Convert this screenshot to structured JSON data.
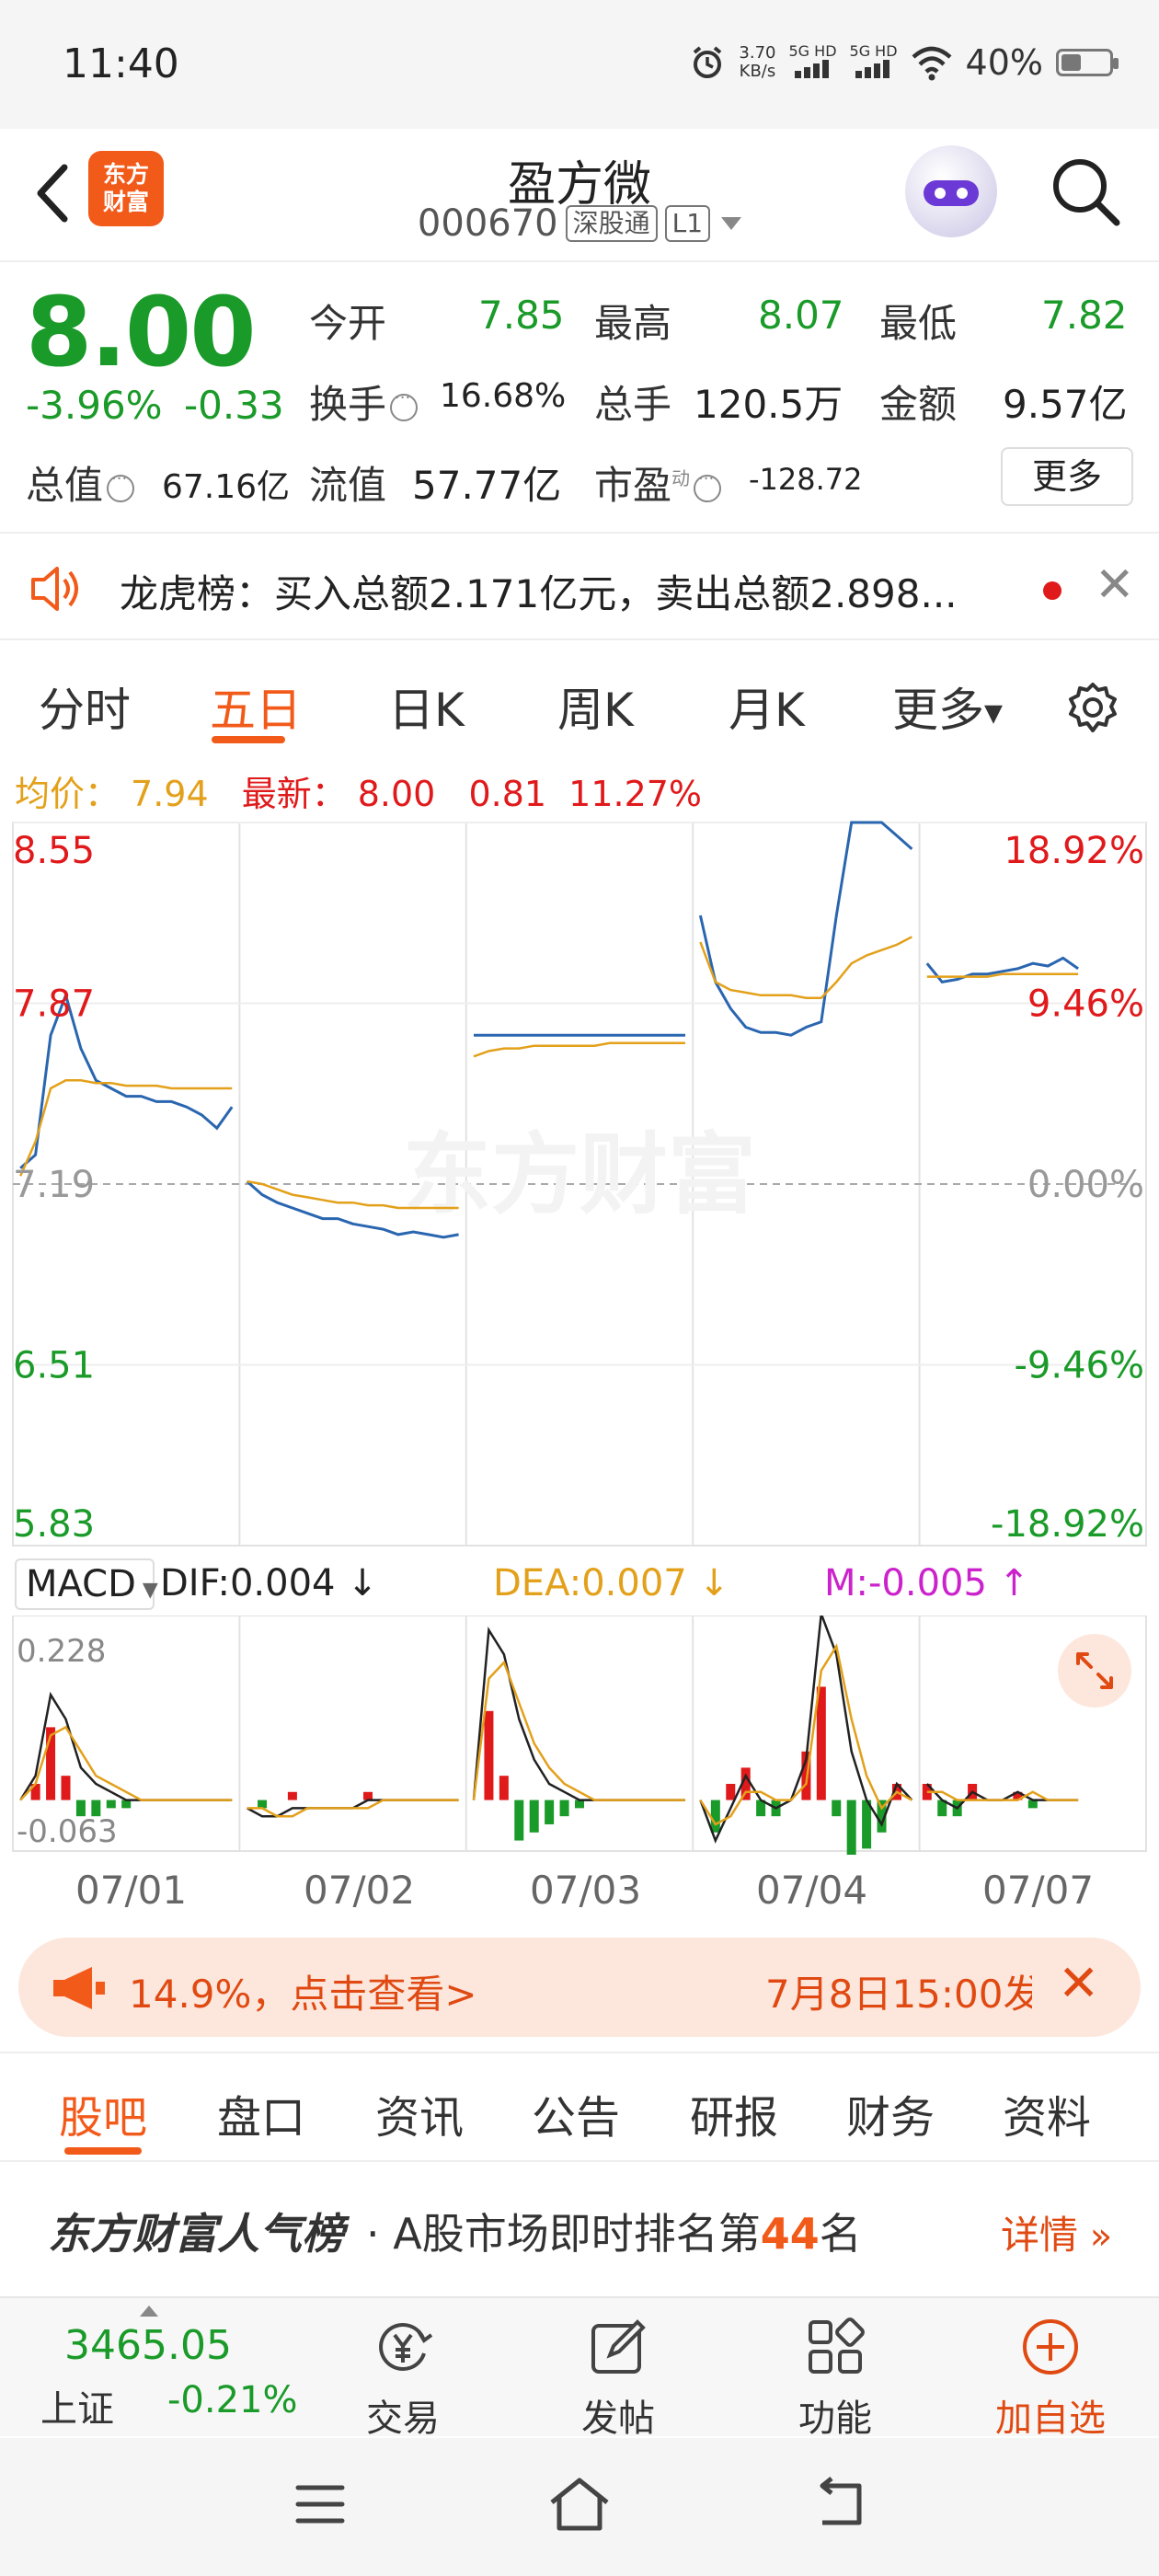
{
  "status_bar": {
    "time": "11:40",
    "net_speed_value": "3.70",
    "net_speed_unit": "KB/s",
    "signal1": "5G HD",
    "signal2": "5G HD",
    "battery": "40%",
    "battery_level": 0.4
  },
  "header": {
    "logo_line1": "东方",
    "logo_line2": "财富",
    "stock_name": "盈方微",
    "stock_code": "000670",
    "tag_connect": "深股通",
    "tag_level": "L1"
  },
  "quote": {
    "price": "8.00",
    "change_pct": "-3.96%",
    "change_amt": "-0.33",
    "open_label": "今开",
    "open": "7.85",
    "high_label": "最高",
    "high": "8.07",
    "low_label": "最低",
    "low": "7.82",
    "turnover_label": "换手",
    "turnover": "16.68%",
    "volume_label": "总手",
    "volume": "120.5万",
    "amount_label": "金额",
    "amount": "9.57亿",
    "mktcap_label": "总值",
    "mktcap": "67.16亿",
    "float_label": "流值",
    "float_cap": "57.77亿",
    "pe_label": "市盈",
    "pe_sup": "动",
    "pe": "-128.72",
    "more_button": "更多"
  },
  "notice": {
    "text": "龙虎榜：买入总额2.171亿元，卖出总额2.898..."
  },
  "chart_tabs": [
    "分时",
    "五日",
    "日K",
    "周K",
    "月K",
    "更多"
  ],
  "chart_header": {
    "avg_label": "均价：",
    "avg_value": "7.94",
    "latest_label": "最新：",
    "latest_value": "8.00",
    "latest_chg": "0.81",
    "latest_pct": "11.27%"
  },
  "chart_data": {
    "type": "line",
    "title": "",
    "x_dates": [
      "07/01",
      "07/02",
      "07/03",
      "07/04",
      "07/07"
    ],
    "y_left_labels": [
      "8.55",
      "7.87",
      "7.19",
      "6.51",
      "5.83"
    ],
    "y_right_labels": [
      "18.92%",
      "9.46%",
      "0.00%",
      "-9.46%",
      "-18.92%"
    ],
    "ylim": [
      5.83,
      8.55
    ],
    "prev_close": 7.19,
    "series": [
      {
        "color": "#2a66b0",
        "values": [
          [
            7.25,
            7.3,
            7.75,
            7.9,
            7.7,
            7.58,
            7.55,
            7.52,
            7.52,
            7.5,
            7.5,
            7.48,
            7.45,
            7.4,
            7.48
          ],
          [
            7.2,
            7.15,
            7.12,
            7.1,
            7.08,
            7.06,
            7.06,
            7.04,
            7.03,
            7.02,
            7.0,
            7.01,
            7.0,
            6.99,
            7.0
          ],
          [
            7.75,
            7.75,
            7.75,
            7.75,
            7.75,
            7.75,
            7.75,
            7.75,
            7.75,
            7.75,
            7.75,
            7.75,
            7.75,
            7.75,
            7.75
          ],
          [
            8.2,
            7.95,
            7.85,
            7.78,
            7.76,
            7.76,
            7.75,
            7.78,
            7.8,
            8.2,
            8.55,
            8.55,
            8.55,
            8.5,
            8.45
          ],
          [
            8.02,
            7.95,
            7.96,
            7.98,
            7.98,
            7.99,
            8.0,
            8.02,
            8.01,
            8.04,
            8.0
          ]
        ]
      },
      {
        "color": "#e3a01a",
        "values": [
          [
            7.22,
            7.35,
            7.55,
            7.58,
            7.58,
            7.57,
            7.57,
            7.56,
            7.56,
            7.56,
            7.55,
            7.55,
            7.55,
            7.55,
            7.55
          ],
          [
            7.2,
            7.19,
            7.17,
            7.15,
            7.14,
            7.13,
            7.12,
            7.12,
            7.11,
            7.11,
            7.1,
            7.1,
            7.1,
            7.1,
            7.1
          ],
          [
            7.67,
            7.69,
            7.7,
            7.7,
            7.71,
            7.71,
            7.71,
            7.71,
            7.71,
            7.72,
            7.72,
            7.72,
            7.72,
            7.72,
            7.72
          ],
          [
            8.1,
            7.95,
            7.92,
            7.91,
            7.9,
            7.9,
            7.9,
            7.89,
            7.89,
            7.95,
            8.02,
            8.05,
            8.07,
            8.09,
            8.12
          ],
          [
            7.97,
            7.97,
            7.97,
            7.97,
            7.97,
            7.98,
            7.98,
            7.98,
            7.98,
            7.98,
            7.98
          ]
        ]
      }
    ]
  },
  "macd": {
    "selector": "MACD",
    "dif_label": "DIF:0.004",
    "dea_label": "DEA:0.007",
    "m_label": "M:-0.005",
    "y_top": "0.228",
    "y_bottom": "-0.063",
    "ylim": [
      -0.063,
      0.228
    ],
    "dif": [
      [
        0.0,
        0.03,
        0.13,
        0.1,
        0.04,
        0.02,
        0.01,
        0.0,
        0.0,
        0.0,
        0.0,
        0.0,
        0.0,
        0.0,
        0.0
      ],
      [
        -0.01,
        -0.02,
        -0.02,
        -0.01,
        -0.01,
        -0.01,
        -0.01,
        -0.01,
        0.0,
        0.0,
        0.0,
        0.0,
        0.0,
        0.0,
        0.0
      ],
      [
        0.0,
        0.21,
        0.18,
        0.1,
        0.05,
        0.02,
        0.01,
        0.0,
        0.0,
        0.0,
        0.0,
        0.0,
        0.0,
        0.0,
        0.0
      ],
      [
        0.0,
        -0.05,
        -0.01,
        0.03,
        0.0,
        -0.01,
        0.0,
        0.05,
        0.23,
        0.18,
        0.06,
        0.0,
        -0.03,
        0.02,
        0.0
      ],
      [
        0.02,
        0.0,
        -0.01,
        0.01,
        0.0,
        0.0,
        0.01,
        0.0,
        0.0,
        0.0,
        0.0
      ]
    ],
    "dea": [
      [
        0.0,
        0.02,
        0.08,
        0.09,
        0.06,
        0.03,
        0.02,
        0.01,
        0.0,
        0.0,
        0.0,
        0.0,
        0.0,
        0.0,
        0.0
      ],
      [
        -0.01,
        -0.01,
        -0.02,
        -0.02,
        -0.01,
        -0.01,
        -0.01,
        -0.01,
        -0.01,
        0.0,
        0.0,
        0.0,
        0.0,
        0.0,
        0.0
      ],
      [
        0.0,
        0.15,
        0.17,
        0.12,
        0.07,
        0.04,
        0.02,
        0.01,
        0.0,
        0.0,
        0.0,
        0.0,
        0.0,
        0.0,
        0.0
      ],
      [
        0.0,
        -0.03,
        -0.02,
        0.01,
        0.01,
        0.0,
        0.0,
        0.02,
        0.16,
        0.19,
        0.1,
        0.03,
        -0.01,
        0.01,
        0.0
      ],
      [
        0.01,
        0.01,
        0.0,
        0.0,
        0.0,
        0.0,
        0.0,
        0.01,
        0.0,
        0.0,
        0.0
      ]
    ],
    "hist": [
      [
        0.0,
        0.02,
        0.09,
        0.03,
        -0.02,
        -0.02,
        -0.01,
        -0.01,
        0.0,
        0.0,
        0.0,
        0.0,
        0.0,
        0.0,
        0.0
      ],
      [
        0.0,
        -0.01,
        0.0,
        0.01,
        0.0,
        0.0,
        0.0,
        0.0,
        0.01,
        0.0,
        0.0,
        0.0,
        0.0,
        0.0,
        0.0
      ],
      [
        0.0,
        0.11,
        0.03,
        -0.05,
        -0.04,
        -0.03,
        -0.02,
        -0.01,
        0.0,
        0.0,
        0.0,
        0.0,
        0.0,
        0.0,
        0.0
      ],
      [
        0.0,
        -0.04,
        0.02,
        0.04,
        -0.02,
        -0.02,
        0.0,
        0.06,
        0.14,
        -0.02,
        -0.08,
        -0.06,
        -0.04,
        0.02,
        0.0
      ],
      [
        0.02,
        -0.02,
        -0.02,
        0.02,
        0.0,
        0.0,
        0.01,
        -0.01,
        0.0,
        0.0,
        0.0
      ]
    ]
  },
  "promo": {
    "text": "14.9%，点击查看>",
    "date": "7月8日15:00发"
  },
  "bottom_tabs": [
    "股吧",
    "盘口",
    "资讯",
    "公告",
    "研报",
    "财务",
    "资料"
  ],
  "rank": {
    "brand": "东方财富人气榜",
    "text_prefix": "· A股市场即时排名第",
    "rank_num": "44",
    "text_suffix": "名",
    "link": "详情"
  },
  "bottom_bar": {
    "index_value": "3465.05",
    "index_name": "上证",
    "index_change": "-0.21%",
    "trade": "交易",
    "post": "发帖",
    "functions": "功能",
    "add": "加自选"
  },
  "colors": {
    "accent": "#f25a1a",
    "up": "#e0191b",
    "down": "#1a9a28",
    "price_line": "#2a66b0",
    "avg_line": "#e3a01a"
  }
}
